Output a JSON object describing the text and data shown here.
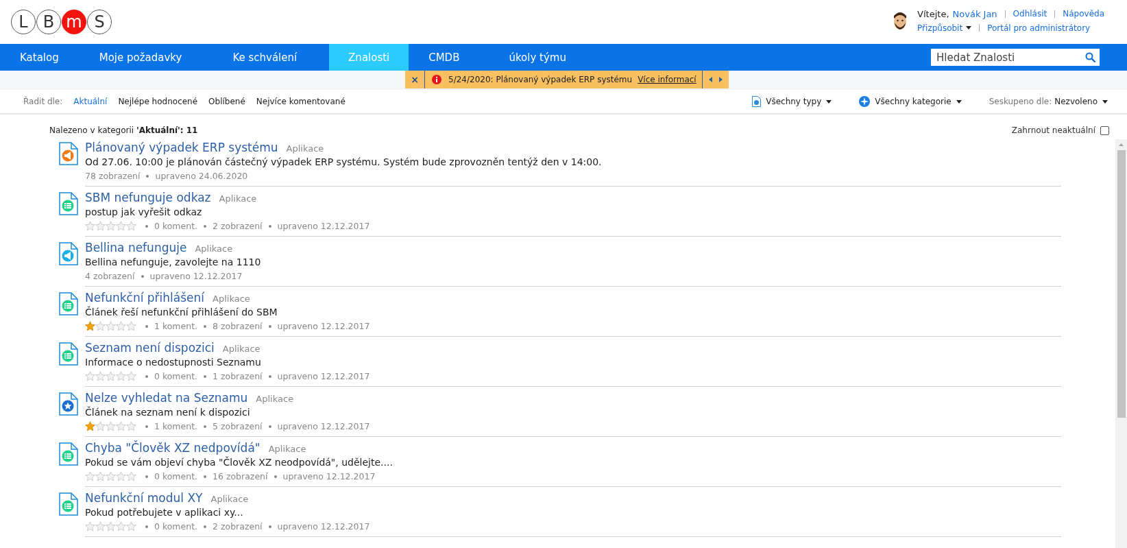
{
  "logo": {
    "letters": [
      {
        "char": "L",
        "highlighted": false
      },
      {
        "char": "B",
        "highlighted": false
      },
      {
        "char": "m",
        "highlighted": true
      },
      {
        "char": "S",
        "highlighted": false
      }
    ]
  },
  "user": {
    "greeting": "Vítejte,",
    "name": "Novák Jan",
    "links_top": [
      "Odhlásit",
      "Nápověda"
    ],
    "customize": "Přizpůsobit",
    "links_bottom": [
      "Portál pro administrátory"
    ]
  },
  "nav": {
    "tabs": [
      {
        "label": "Katalog",
        "selected": false
      },
      {
        "label": "Moje požadavky",
        "selected": false
      },
      {
        "label": "Ke schválení",
        "selected": false
      },
      {
        "label": "Znalosti",
        "selected": true
      },
      {
        "label": "CMDB",
        "selected": false
      },
      {
        "label": "úkoly týmu",
        "selected": false
      }
    ],
    "search": {
      "placeholder": "Hledat Znalosti"
    }
  },
  "alert": {
    "close": "×",
    "text": "5/24/2020: Plánovaný výpadek ERP systému",
    "link": "Více informací"
  },
  "sort_bar": {
    "label": "Řadit dle:",
    "options": [
      {
        "label": "Aktuální",
        "selected": true
      },
      {
        "label": "Nejlépe hodnocené",
        "selected": false
      },
      {
        "label": "Oblíbené",
        "selected": false
      },
      {
        "label": "Nejvíce komentované",
        "selected": false
      }
    ],
    "types": "Všechny typy",
    "categories": "Všechny kategorie",
    "group_label": "Seskupeno dle:",
    "group_value": "Nezvoleno"
  },
  "summary": {
    "prefix": "Nalezeno v kategorii",
    "category": "'Aktuální'",
    "count": ": 11"
  },
  "include_outdated": {
    "label": "Zahrnout neaktuální",
    "checked": false
  },
  "articles": [
    {
      "kind": "announcement",
      "color": "#f07c1a",
      "title": "Plánovaný výpadek ERP systému",
      "category": "Aplikace",
      "summary": "Od 27.06. 10:00 je plánován částečný výpadek ERP systému. Systém bude zprovozněn tentýž den v 14:00.",
      "views": "78 zobrazení",
      "modified": "upraveno 24.06.2020"
    },
    {
      "kind": "list",
      "color": "#1fd28a",
      "title": "SBM nefunguje odkaz",
      "category": "Aplikace",
      "summary": "postup jak vyřešit odkaz",
      "stars": 0,
      "comments": "0 koment.",
      "views": "2 zobrazení",
      "modified": "upraveno 12.12.2017"
    },
    {
      "kind": "announcement",
      "color": "#1ab0e8",
      "title": "Bellina nefunguje",
      "category": "Aplikace",
      "summary": "Bellina nefunguje, zavolejte na 1110",
      "views": "4 zobrazení",
      "modified": "upraveno 12.12.2017"
    },
    {
      "kind": "list",
      "color": "#1fd28a",
      "title": "Nefunkční přihlášení",
      "category": "Aplikace",
      "summary": "Článek řeší nefunkční přihlášení do SBM",
      "stars": 1,
      "comments": "1 koment.",
      "views": "8 zobrazení",
      "modified": "upraveno 12.12.2017"
    },
    {
      "kind": "list",
      "color": "#1fd28a",
      "title": "Seznam není dispozici",
      "category": "Aplikace",
      "summary": "Informace o nedostupnosti Seznamu",
      "stars": 0,
      "comments": "0 koment.",
      "views": "1 zobrazení",
      "modified": "upraveno 12.12.2017"
    },
    {
      "kind": "star",
      "color": "#1a6fd0",
      "title": "Nelze vyhledat na Seznamu",
      "category": "Aplikace",
      "summary": "Článek na seznam není k dispozici",
      "stars": 1,
      "comments": "1 koment.",
      "views": "5 zobrazení",
      "modified": "upraveno 12.12.2017"
    },
    {
      "kind": "list",
      "color": "#1fd28a",
      "title": "Chyba \"Člověk XZ nedpovídá\"",
      "category": "Aplikace",
      "summary": "Pokud se vám objeví chyba \"Člověk XZ neodpovídá\", udělejte....",
      "stars": 0,
      "comments": "0 koment.",
      "views": "16 zobrazení",
      "modified": "upraveno 12.12.2017"
    },
    {
      "kind": "list",
      "color": "#1fd28a",
      "title": "Nefunkční modul XY",
      "category": "Aplikace",
      "summary": "Pokud potřebujete v aplikaci xy...",
      "stars": 0,
      "comments": "0 koment.",
      "views": "2 zobrazení",
      "modified": "upraveno 12.12.2017"
    }
  ]
}
